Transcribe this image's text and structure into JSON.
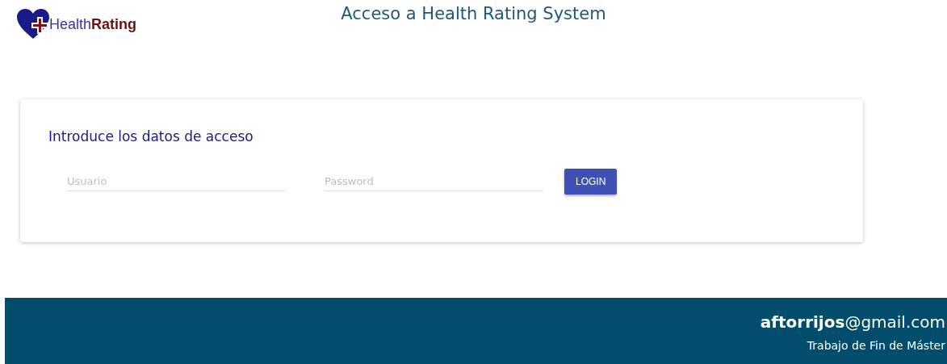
{
  "header": {
    "logo_text": "Health**Rating**",
    "title": "Acceso a Health Rating System"
  },
  "login_card": {
    "heading": "Introduce los datos de acceso",
    "fields": [
      {
        "placeholder": "Usuario"
      },
      {
        "placeholder": "Password"
      }
    ],
    "button": "LOGIN"
  },
  "footer": {
    "email": "**aftorrijos**@gmail.com",
    "subtitle": "Trabajo de Fin de Máster"
  }
}
